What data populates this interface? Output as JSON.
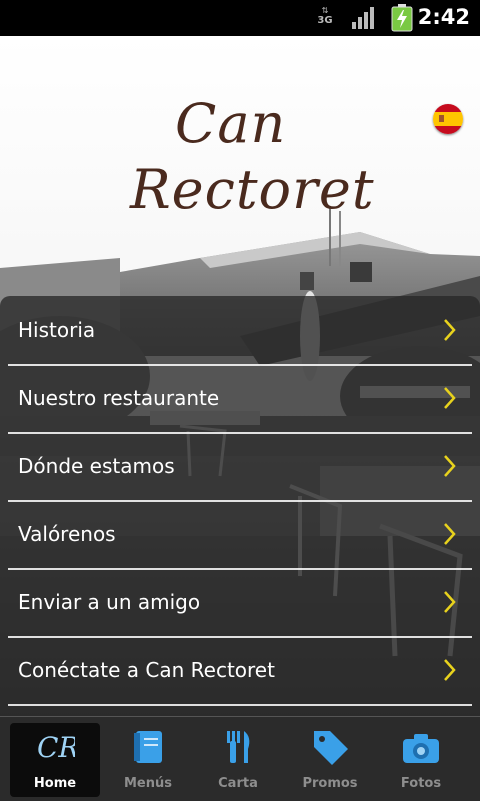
{
  "status_bar": {
    "time": "2:42",
    "network": "3G"
  },
  "logo": {
    "line1": "Can",
    "line2": "Rectoret"
  },
  "language_flag": "flag-spain-icon",
  "menu": {
    "items": [
      {
        "label": "Historia"
      },
      {
        "label": "Nuestro restaurante"
      },
      {
        "label": "Dónde estamos"
      },
      {
        "label": "Valórenos"
      },
      {
        "label": "Enviar a un amigo"
      },
      {
        "label": "Conéctate a Can Rectoret"
      }
    ]
  },
  "tabs": [
    {
      "label": "Home",
      "icon": "home-logo-icon",
      "active": true
    },
    {
      "label": "Menús",
      "icon": "menus-icon",
      "active": false
    },
    {
      "label": "Carta",
      "icon": "cutlery-icon",
      "active": false
    },
    {
      "label": "Promos",
      "icon": "tag-icon",
      "active": false
    },
    {
      "label": "Fotos",
      "icon": "camera-icon",
      "active": false
    }
  ],
  "colors": {
    "logo_brown": "#4a2a1e",
    "chevron_yellow": "#e8d21d",
    "tab_icon_blue": "#3aa0e8"
  }
}
